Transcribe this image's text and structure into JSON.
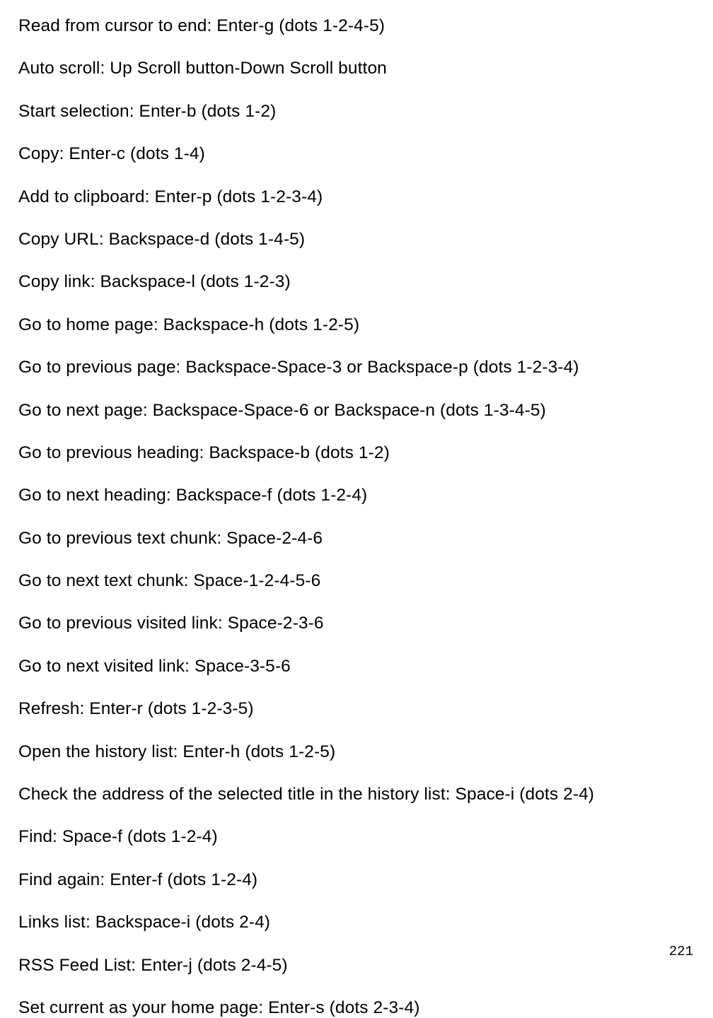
{
  "lines": [
    "Read from cursor to end: Enter-g (dots 1-2-4-5)",
    "Auto scroll: Up Scroll button-Down Scroll button",
    "Start selection: Enter-b (dots 1-2)",
    "Copy: Enter-c (dots 1-4)",
    "Add to clipboard: Enter-p (dots 1-2-3-4)",
    "Copy URL: Backspace-d (dots 1-4-5)",
    "Copy link: Backspace-l (dots 1-2-3)",
    "Go to home page: Backspace-h (dots 1-2-5)",
    "Go to previous page: Backspace-Space-3 or Backspace-p (dots 1-2-3-4)",
    "Go to next page: Backspace-Space-6 or Backspace-n (dots 1-3-4-5)",
    "Go to previous heading: Backspace-b (dots 1-2)",
    "Go to next heading: Backspace-f (dots 1-2-4)",
    "Go to previous text chunk: Space-2-4-6",
    "Go to next text chunk: Space-1-2-4-5-6",
    "Go to previous visited link: Space-2-3-6",
    "Go to next visited link: Space-3-5-6",
    "Refresh: Enter-r (dots 1-2-3-5)",
    "Open the history list: Enter-h (dots 1-2-5)",
    "Check the address of the selected title in the history list: Space-i (dots 2-4)",
    "Find: Space-f (dots 1-2-4)",
    "Find again: Enter-f (dots 1-2-4)",
    "Links list: Backspace-i (dots 2-4)",
    "RSS Feed List: Enter-j (dots 2-4-5)",
    "Set current as your home page: Enter-s (dots 2-3-4)"
  ],
  "pageNumber": "221"
}
